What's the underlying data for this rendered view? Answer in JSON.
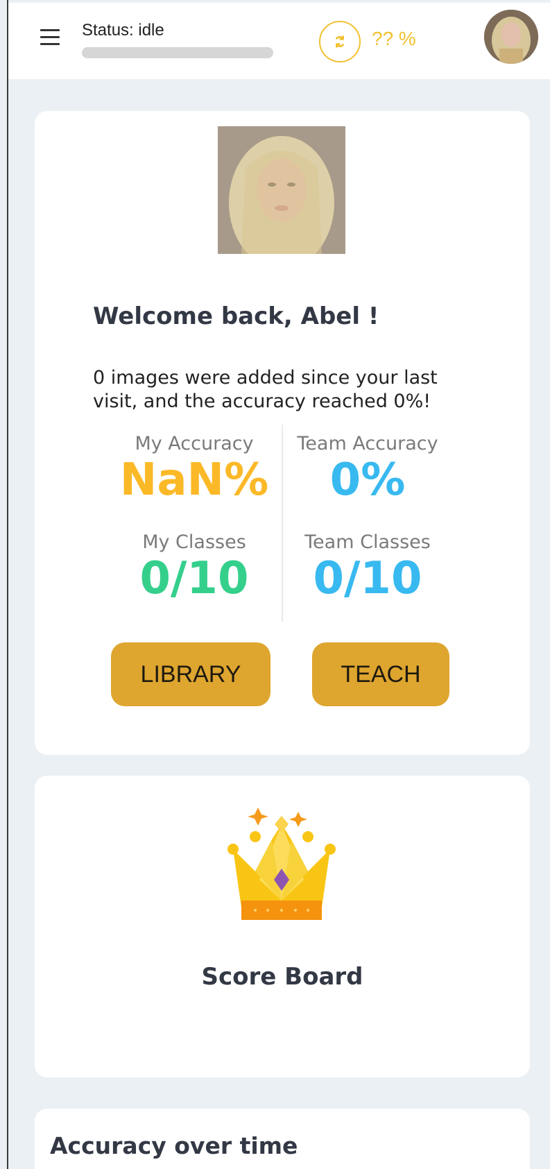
{
  "header": {
    "status_text": "Status: idle",
    "status_progress": 0,
    "sync_icon": "sync-icon",
    "percent_text": "?? %",
    "menu_icon": "hamburger-menu-icon"
  },
  "welcome": {
    "title": "Welcome back, Abel !",
    "message": "0 images were added since your last visit, and the accuracy reached 0%!",
    "stats": {
      "my_accuracy_label": "My Accuracy",
      "my_accuracy_value": "NaN%",
      "team_accuracy_label": "Team Accuracy",
      "team_accuracy_value": "0%",
      "my_classes_label": "My Classes",
      "my_classes_value": "0/10",
      "team_classes_label": "Team Classes",
      "team_classes_value": "0/10"
    },
    "buttons": {
      "library": "LIBRARY",
      "teach": "TEACH"
    }
  },
  "score_board": {
    "icon": "crown-icon",
    "title": "Score Board"
  },
  "chart_card": {
    "title": "Accuracy over time"
  },
  "colors": {
    "accent": "#dea52f",
    "accent_light": "#f2c132",
    "my_accuracy": "#fbb928",
    "team": "#38b9f0",
    "my_classes": "#35cf8c",
    "background": "#ebf0f4"
  }
}
